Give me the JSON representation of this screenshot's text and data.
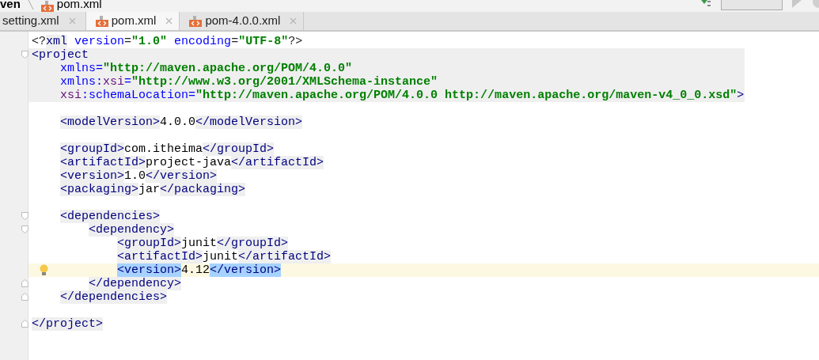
{
  "breadcrumb": [
    "ven",
    "pom.xml"
  ],
  "tabs": [
    {
      "label": "setting.xml",
      "selected": false,
      "icon": false
    },
    {
      "label": "pom.xml",
      "selected": true,
      "icon": true
    },
    {
      "label": "pom-4.0.0.xml",
      "selected": false,
      "icon": true
    }
  ],
  "lines": [
    {
      "kind": "code",
      "tokens": [
        {
          "kind": "punct",
          "text": "<?"
        },
        {
          "kind": "tag",
          "text": "xml"
        },
        {
          "kind": "attr",
          "text": " version"
        },
        {
          "kind": "punct",
          "text": "="
        },
        {
          "kind": "val",
          "text": "\"1.0\""
        },
        {
          "kind": "attr",
          "text": " encoding"
        },
        {
          "kind": "punct",
          "text": "="
        },
        {
          "kind": "val",
          "text": "\"UTF-8\""
        },
        {
          "kind": "punct",
          "text": "?>"
        }
      ]
    },
    {
      "kind": "code",
      "fold_start": true,
      "shaded": true,
      "tokens": [
        {
          "kind": "tag",
          "text": "<project"
        }
      ]
    },
    {
      "kind": "code",
      "shaded": true,
      "tokens": [
        {
          "kind": "attr",
          "text": "    xmlns="
        },
        {
          "kind": "val",
          "text": "\"http://maven.apache.org/POM/4.0.0\""
        }
      ]
    },
    {
      "kind": "code",
      "shaded": true,
      "tokens": [
        {
          "kind": "attr",
          "text": "    xmlns:"
        },
        {
          "kind": "ns",
          "text": "xsi"
        },
        {
          "kind": "attr",
          "text": "="
        },
        {
          "kind": "val",
          "text": "\"http://www.w3.org/2001/XMLSchema-instance\""
        }
      ]
    },
    {
      "kind": "code",
      "shaded": true,
      "tokens": [
        {
          "kind": "ns",
          "text": "    xsi"
        },
        {
          "kind": "attr",
          "text": ":schemaLocation="
        },
        {
          "kind": "val",
          "text": "\"http://maven.apache.org/POM/4.0.0 http://maven.apache.org/maven-v4_0_0.xsd\""
        },
        {
          "kind": "tag",
          "text": ">"
        }
      ]
    },
    {
      "kind": "blank"
    },
    {
      "kind": "code",
      "tokens": [
        {
          "kind": "tag",
          "text": "    <modelVersion>"
        },
        {
          "kind": "plain",
          "text": "4.0.0"
        },
        {
          "kind": "tag",
          "text": "</modelVersion>"
        }
      ]
    },
    {
      "kind": "blank"
    },
    {
      "kind": "code",
      "tokens": [
        {
          "kind": "tag",
          "text": "    <groupId>"
        },
        {
          "kind": "plain",
          "text": "com.itheima"
        },
        {
          "kind": "tag",
          "text": "</groupId>"
        }
      ]
    },
    {
      "kind": "code",
      "tokens": [
        {
          "kind": "tag",
          "text": "    <artifactId>"
        },
        {
          "kind": "plain",
          "text": "project-java"
        },
        {
          "kind": "tag",
          "text": "</artifactId>"
        }
      ]
    },
    {
      "kind": "code",
      "tokens": [
        {
          "kind": "tag",
          "text": "    <version>"
        },
        {
          "kind": "plain",
          "text": "1.0"
        },
        {
          "kind": "tag",
          "text": "</version>"
        }
      ]
    },
    {
      "kind": "code",
      "tokens": [
        {
          "kind": "tag",
          "text": "    <packaging>"
        },
        {
          "kind": "plain",
          "text": "jar"
        },
        {
          "kind": "tag",
          "text": "</packaging>"
        }
      ]
    },
    {
      "kind": "blank"
    },
    {
      "kind": "code",
      "fold_start": true,
      "tokens": [
        {
          "kind": "tag",
          "text": "    <dependencies>"
        }
      ]
    },
    {
      "kind": "code",
      "fold_start": true,
      "tokens": [
        {
          "kind": "tag",
          "text": "        <dependency>"
        }
      ]
    },
    {
      "kind": "code",
      "tokens": [
        {
          "kind": "tag",
          "text": "            <groupId>"
        },
        {
          "kind": "plain",
          "text": "junit"
        },
        {
          "kind": "tag",
          "text": "</groupId>"
        }
      ]
    },
    {
      "kind": "code",
      "tokens": [
        {
          "kind": "tag",
          "text": "            <artifactId>"
        },
        {
          "kind": "plain",
          "text": "junit"
        },
        {
          "kind": "tag",
          "text": "</artifactId>"
        }
      ]
    },
    {
      "kind": "code",
      "current": true,
      "bulb": true,
      "tokens": [
        {
          "kind": "tag",
          "text": "            <version>",
          "selected": true
        },
        {
          "kind": "plain",
          "text": "4.12",
          "selected": false
        },
        {
          "kind": "tag",
          "text": "</version>",
          "selected": true
        }
      ]
    },
    {
      "kind": "code",
      "fold_end": true,
      "tokens": [
        {
          "kind": "tag",
          "text": "        </dependency>"
        }
      ]
    },
    {
      "kind": "code",
      "fold_end": true,
      "tokens": [
        {
          "kind": "tag",
          "text": "    </dependencies>"
        }
      ]
    },
    {
      "kind": "blank"
    },
    {
      "kind": "code",
      "fold_end": true,
      "tokens": [
        {
          "kind": "tag",
          "text": "</project>"
        }
      ]
    }
  ]
}
